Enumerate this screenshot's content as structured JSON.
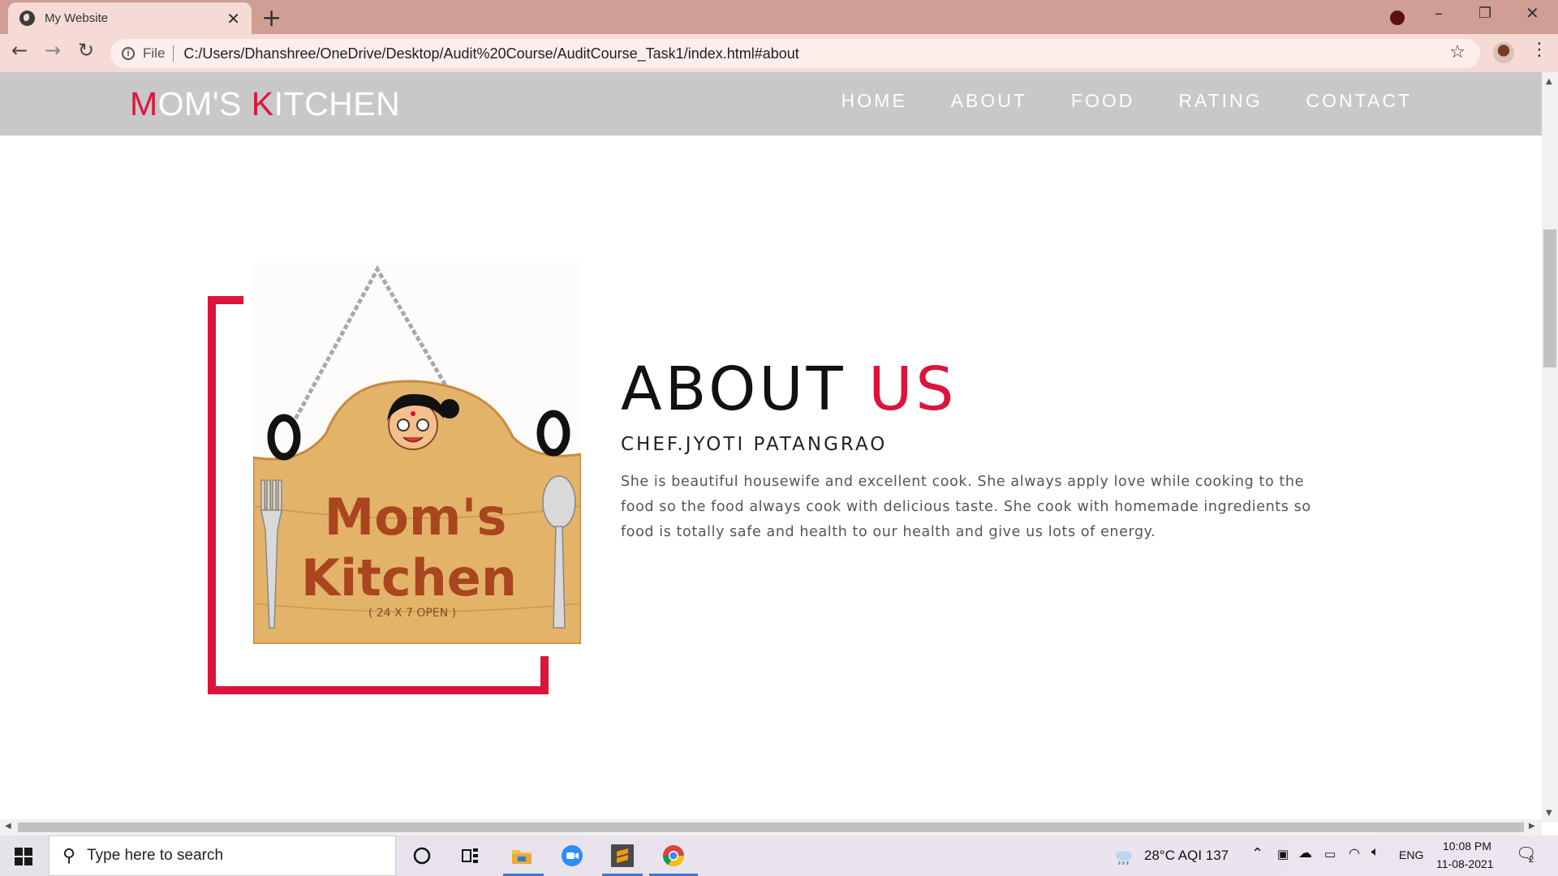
{
  "browser": {
    "tab_title": "My Website",
    "tab_close": "✕",
    "new_tab": "+",
    "address_scheme": "File",
    "address_url": "C:/Users/Dhanshree/OneDrive/Desktop/Audit%20Course/AuditCourse_Task1/index.html#about",
    "star": "☆",
    "back": "←",
    "forward": "→",
    "reload": "↻",
    "minimize": "–",
    "maximize": "❐",
    "close": "✕",
    "menu": "⋮"
  },
  "site": {
    "logo_first_accent": "M",
    "logo_first_rest": "OM'S ",
    "logo_second_accent": "K",
    "logo_second_rest": "ITCHEN",
    "nav": [
      "HOME",
      "ABOUT",
      "FOOD",
      "RATING",
      "CONTACT"
    ],
    "accent_color": "#dc143c"
  },
  "about": {
    "heading_main": "ABOUT ",
    "heading_accent": "US",
    "chef": "CHEF.JYOTI PATANGRAO",
    "description": "She is beautiful housewife and excellent cook. She always apply love while cooking to the food so the food always cook with delicious taste. She cook with homemade ingredients so food is totally safe and health to our health and give us lots of energy."
  },
  "sign_image": {
    "title_line1": "Mom's",
    "title_line2": "Kitchen",
    "subtitle": "( 24 X 7  OPEN )"
  },
  "taskbar": {
    "search_placeholder": "Type here to search",
    "weather": "28°C  AQI 137",
    "language": "ENG",
    "time": "10:08 PM",
    "date": "11-08-2021",
    "notification_count": "2"
  }
}
